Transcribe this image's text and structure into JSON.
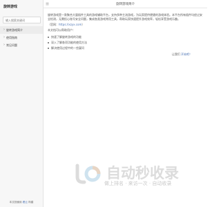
{
  "sidebar": {
    "brand": "旋转游戏",
    "search_placeholder": "输入搜索关键词",
    "items": [
      {
        "label": "旋转游戏简介",
        "active": true
      },
      {
        "label": "使用指南",
        "active": false
      },
      {
        "label": "常见问题",
        "active": false
      }
    ],
    "footer_prefix": "本文档使用 ",
    "footer_link": "看云",
    "footer_suffix": " 构建"
  },
  "header": {
    "title": "旋转游戏简介"
  },
  "content": {
    "intro": "旋转游戏是一款聚合大量插件工具的游戏辅助平台，支持多种主流游戏，为玩家提供便捷的游戏体验。本平台所有插件均经过安全检测，无需担心账号安全问题，集成各类游戏常用工具，帮助玩家快速提升游戏效率，轻松享受游戏乐趣。",
    "website_prefix": "（官网：",
    "website_link": "https://xzyx.com",
    "website_suffix": "）",
    "list_heading": "本文档可以帮助用户：",
    "list_items": [
      "快速了解旋转游戏的功能",
      "深入了解各项功能的使用方法",
      "解决使用过程中的一些疑问"
    ],
    "ending_text": "让我们 ",
    "ending_link": "开始吧！"
  },
  "watermark": {
    "title": "自动秒收录",
    "subtitle": "做上排名 · 来访一次 · 自动收录"
  },
  "colors": {
    "link": "#4c74b4",
    "sidebar_bg": "#f7f7f7",
    "active_bg": "#ececec"
  }
}
